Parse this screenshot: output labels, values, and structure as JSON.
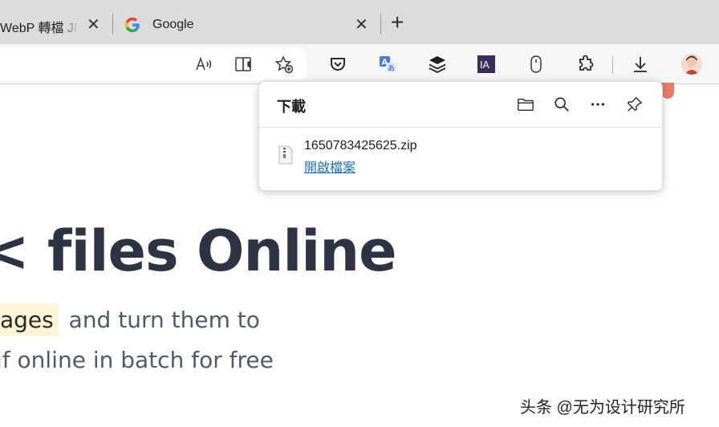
{
  "tabs": [
    {
      "title": "WebP 轉檔 JPG",
      "close_glyph": "✕"
    },
    {
      "title": "Google",
      "icon": "google-g-icon",
      "close_glyph": "✕"
    }
  ],
  "new_tab_glyph": "+",
  "toolbar": {
    "icons": [
      "read-aloud-icon",
      "immersive-reader-icon",
      "add-favorite-icon",
      "pocket-icon",
      "translate-icon",
      "layers-icon",
      "ia-icon",
      "mouse-icon",
      "extensions-icon",
      "download-icon",
      "profile-avatar"
    ],
    "ia_label": "IA"
  },
  "downloads": {
    "title": "下載",
    "actions": [
      "open-folder-icon",
      "search-icon",
      "more-icon",
      "pin-icon"
    ],
    "items": [
      {
        "file_name": "1650783425625.zip",
        "action_label": "開啟檔案"
      }
    ],
    "link_color": "#1a6fb5"
  },
  "page": {
    "heading": "< files Online",
    "highlight": "ages",
    "line1_rest": "and turn them to",
    "line2": "if online in batch for free"
  },
  "watermark": "头条 @无为设计研究所"
}
